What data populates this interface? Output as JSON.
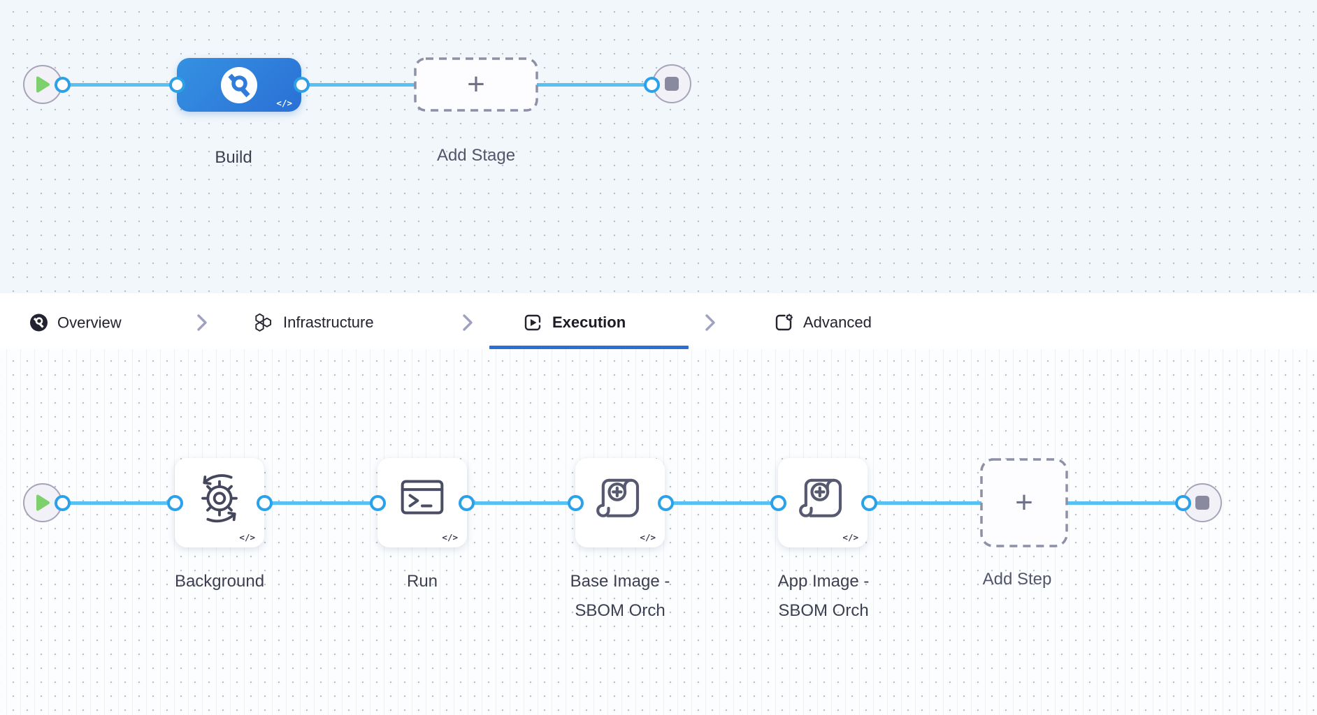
{
  "canvas": {
    "code_badge": "</>",
    "plus": "+"
  },
  "stage_pipeline": {
    "start_node": "pipeline-start",
    "end_node": "pipeline-end",
    "stages": [
      {
        "name": "Build",
        "type": "ci-stage",
        "selected": true
      },
      {
        "name": "Add Stage",
        "type": "add-button"
      }
    ]
  },
  "tab_bar": {
    "tabs": [
      {
        "label": "Overview",
        "icon": "ci-module-icon",
        "active": false
      },
      {
        "label": "Infrastructure",
        "icon": "hexagons-icon",
        "active": false
      },
      {
        "label": "Execution",
        "icon": "play-square-icon",
        "active": true
      },
      {
        "label": "Advanced",
        "icon": "square-gear-icon",
        "active": false
      }
    ],
    "active_color": "#2b6fd4"
  },
  "execution_pipeline": {
    "start_node": "execution-start",
    "end_node": "execution-end",
    "steps": [
      {
        "name": "Background",
        "icon": "gear-sync-icon"
      },
      {
        "name": "Run",
        "icon": "terminal-icon"
      },
      {
        "name": "Base Image - SBOM Orch",
        "icon": "scroll-plus-icon"
      },
      {
        "name": "App Image - SBOM Orch",
        "icon": "scroll-plus-icon"
      },
      {
        "name": "Add Step",
        "icon": "plus-icon"
      }
    ]
  },
  "colors": {
    "edge": "#57c1f3",
    "port_border": "#2aa1e8",
    "stage_gradient_start": "#3591e1",
    "stage_gradient_end": "#2a70d6",
    "canvas_top_bg": "#f1f7fb",
    "canvas_bottom_bg": "#fbfdff",
    "label_text": "#3d3f51"
  }
}
